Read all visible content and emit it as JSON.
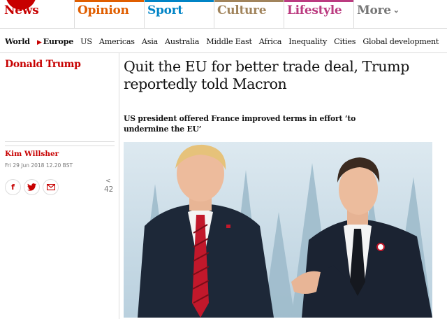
{
  "pillars": [
    {
      "label": "News",
      "color": "#c70000"
    },
    {
      "label": "Opinion",
      "color": "#e05e00"
    },
    {
      "label": "Sport",
      "color": "#0084c6"
    },
    {
      "label": "Culture",
      "color": "#a1845c"
    },
    {
      "label": "Lifestyle",
      "color": "#bb3b80"
    },
    {
      "label": "More",
      "color": "#767676"
    }
  ],
  "subnav": [
    "World",
    "Europe",
    "US",
    "Americas",
    "Asia",
    "Australia",
    "Middle East",
    "Africa",
    "Inequality",
    "Cities",
    "Global development"
  ],
  "article": {
    "section": "Donald Trump",
    "headline": "Quit the EU for better trade deal, Trump reportedly told Macron",
    "standfirst": "US president offered France improved terms in effort ‘to undermine the EU’",
    "author": "Kim Willsher",
    "date": "Fri 29 Jun 2018 12.20 BST",
    "share_count": "42"
  },
  "share_icons": [
    "facebook-icon",
    "twitter-icon",
    "email-icon"
  ],
  "colors": {
    "accent": "#c70000",
    "border": "#dcdcdc",
    "meta": "#767676"
  }
}
